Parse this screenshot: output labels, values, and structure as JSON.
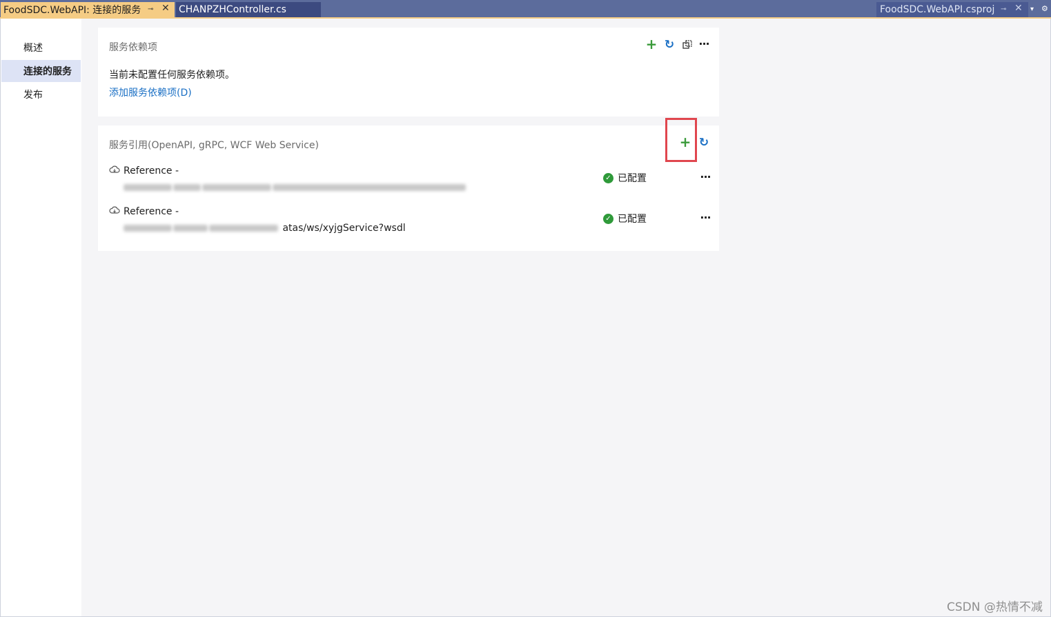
{
  "tabs": {
    "active": {
      "title": "FoodSDC.WebAPI: 连接的服务",
      "pin": "⊸",
      "close": "✕"
    },
    "second": {
      "title": "CHANPZHController.cs"
    },
    "right": {
      "title": "FoodSDC.WebAPI.csproj",
      "pin": "⊸",
      "close": "✕"
    },
    "dropdown": "▾",
    "gear": "⚙"
  },
  "sidebar": {
    "items": [
      {
        "label": "概述"
      },
      {
        "label": "连接的服务"
      },
      {
        "label": "发布"
      }
    ]
  },
  "service_dependencies": {
    "title": "服务依赖项",
    "empty_message": "当前未配置任何服务依赖项。",
    "add_link": "添加服务依赖项(D)"
  },
  "service_references": {
    "title": "服务引用(OpenAPI, gRPC, WCF Web Service)",
    "items": [
      {
        "name": "Reference -",
        "url_visible": "",
        "status": "已配置"
      },
      {
        "name": "Reference -",
        "url_visible": "atas/ws/xyjgService?wsdl",
        "status": "已配置"
      }
    ]
  },
  "icons": {
    "plus": "+",
    "refresh": "↻",
    "ellipsis": "···",
    "check": "✓"
  },
  "colors": {
    "tabstrip": "#5c6c9c",
    "active_tab": "#f5cc84",
    "plus_green": "#3a9a3a",
    "link_blue": "#1a6fc4",
    "highlight_red": "#e0464e",
    "status_green": "#2f9a3a"
  },
  "watermark": "CSDN @热情不减"
}
